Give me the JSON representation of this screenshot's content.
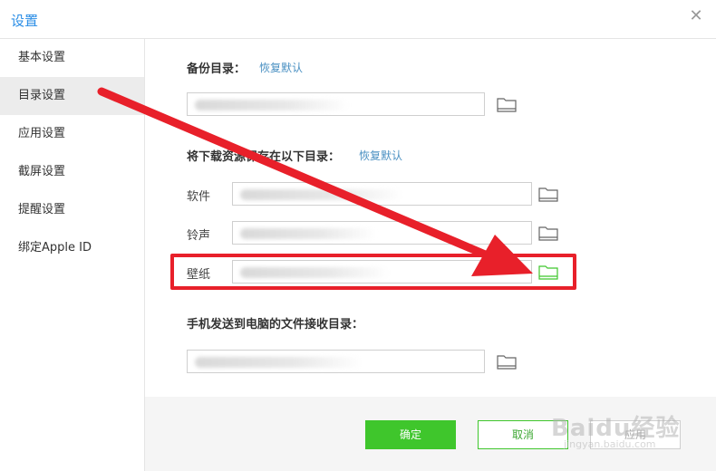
{
  "window": {
    "title": "设置"
  },
  "sidebar": {
    "items": [
      {
        "label": "基本设置"
      },
      {
        "label": "目录设置",
        "active": true
      },
      {
        "label": "应用设置"
      },
      {
        "label": "截屏设置"
      },
      {
        "label": "提醒设置"
      },
      {
        "label": "绑定Apple ID"
      }
    ]
  },
  "backup": {
    "label": "备份目录：",
    "restore": "恢复默认"
  },
  "download": {
    "label": "将下载资源保存在以下目录：",
    "restore": "恢复默认",
    "rows": [
      {
        "label": "软件"
      },
      {
        "label": "铃声"
      },
      {
        "label": "壁纸"
      }
    ]
  },
  "receive": {
    "label": "手机发送到电脑的文件接收目录："
  },
  "footer": {
    "ok": "确定",
    "cancel": "取消",
    "apply": "应用"
  },
  "watermark": {
    "brand": "Baidu经验",
    "url": "jingyan.baidu.com"
  },
  "colors": {
    "accent": "#3fc62c",
    "link": "#4a90c2",
    "annotation": "#e8202a"
  },
  "icons": {
    "close": "close-icon",
    "folder": "folder-icon"
  }
}
